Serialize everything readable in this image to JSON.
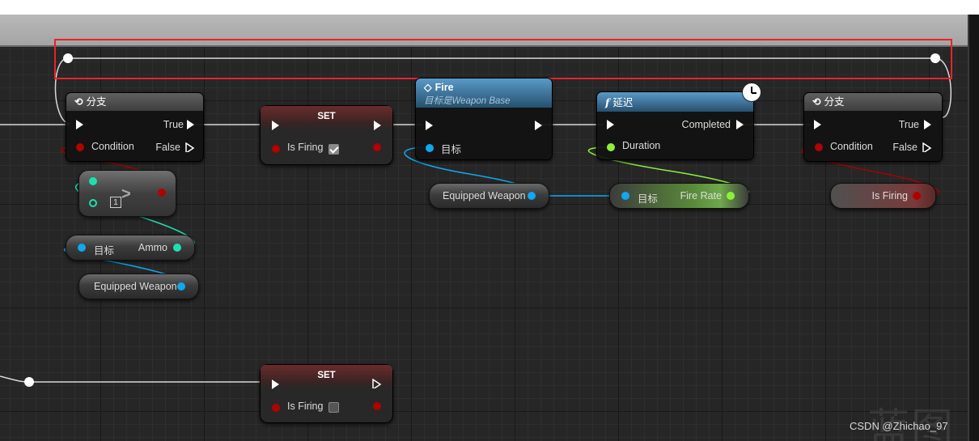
{
  "branch1": {
    "title": "分支",
    "in_pin": "Condition",
    "out_true": "True",
    "out_false": "False"
  },
  "compare": {
    "operator": ">",
    "value": "1"
  },
  "ammo_getter": {
    "target": "目标",
    "output": "Ammo"
  },
  "equipped1": {
    "label": "Equipped Weapon"
  },
  "set_true": {
    "title": "SET",
    "pin": "Is Firing",
    "checked": true
  },
  "fire": {
    "title": "Fire",
    "subtitle": "目标是Weapon Base",
    "target": "目标"
  },
  "equipped2": {
    "label": "Equipped Weapon"
  },
  "delay": {
    "title": "延迟",
    "duration": "Duration",
    "completed": "Completed"
  },
  "fire_rate": {
    "target": "目标",
    "output": "Fire Rate"
  },
  "branch2": {
    "title": "分支",
    "in_pin": "Condition",
    "out_true": "True",
    "out_false": "False"
  },
  "is_firing_getter": {
    "label": "Is Firing"
  },
  "set_false": {
    "title": "SET",
    "pin": "Is Firing",
    "checked": false
  },
  "watermark": {
    "text": "CSDN @Zhichao_97"
  },
  "colors": {
    "selection": "#e8232a",
    "exec": "#ffffff",
    "boolean": "#b00000",
    "object": "#10a8f0",
    "integer": "#1de0b0",
    "float": "#8cf03c"
  }
}
